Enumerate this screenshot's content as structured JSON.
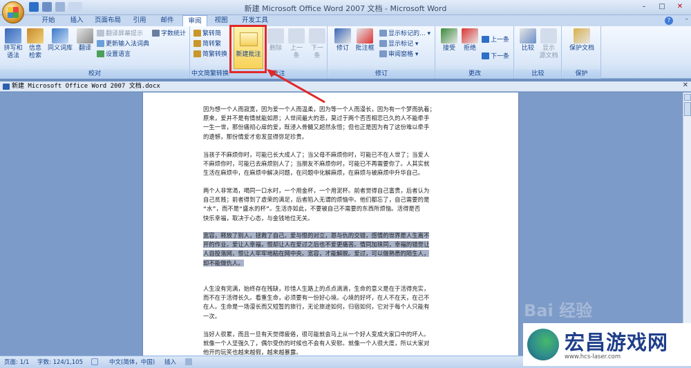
{
  "window": {
    "title": "新建 Microsoft Office Word 2007 文档 - Microsoft Word",
    "minimize": "–",
    "maximize": "□",
    "close": "✕"
  },
  "tabs": [
    "开始",
    "插入",
    "页面布局",
    "引用",
    "邮件",
    "审阅",
    "视图",
    "开发工具"
  ],
  "active_tab": "审阅",
  "ribbon": {
    "proof": {
      "spell": "拼写和\n语法",
      "research": "信息\n检索",
      "thesaurus": "同义词库",
      "translate": "翻译",
      "tooltip": "翻译屏幕提示",
      "update_ime": "更新输入法词典",
      "language": "设置语言",
      "wordcount": "字数统计",
      "label": "校对"
    },
    "chinese": {
      "t2s": "繁转简",
      "s2t": "简转繁",
      "convert": "简繁转换",
      "label": "中文简繁转换"
    },
    "comments": {
      "new": "新建批注",
      "delete": "删除",
      "prev": "上一\n条",
      "next": "下一\n条",
      "label": "批注"
    },
    "tracking": {
      "track": "修订",
      "balloons": "批注框",
      "display_mode": "显示标记的...",
      "show_markup": "显示标记",
      "review_pane": "审阅窗格",
      "label": "修订"
    },
    "changes": {
      "accept": "接受",
      "reject": "拒绝",
      "prev": "上一条",
      "next": "下一条",
      "label": "更改"
    },
    "compare": {
      "compare": "比较",
      "show_source": "显示\n源文档",
      "label": "比较"
    },
    "protect": {
      "protect_doc": "保护文档",
      "label": "保护"
    }
  },
  "document": {
    "tab_name": "新建 Microsoft Office Word 2007 文档.docx",
    "paragraphs": [
      [
        "因为想一个人而寂寞，因为爱一个人而温柔，因为等一个人而漫长，因为有一个梦而执着；",
        "原来，爱并不是有情就能如愿；人世间最大的悲，莫过于两个否否相恋已久的人不能牵手",
        "一生一世，那份痛彻心扉的爱，既浸入骨髓又超然永恒；但也正是因为有了这份难以牵手",
        "的遗憾，那份情爱才愈发显得弥足珍贵。"
      ],
      [
        "当孩子不麻烦你时，可能已长大成人了；当父母不麻烦你时，可能已不在人世了；当爱人",
        "不麻烦你时，可能已去麻烦别人了；当朋友不麻烦你时，可能已不再需要你了。人其实就",
        "生活在麻烦中，在麻烦中解决问题，在问题中化解麻烦，在麻烦与被麻烦中升华自己。"
      ],
      [
        "两个人非常渴，喝同一口水时，一个用金杯，一个用泥杯。前者觉得自己富贵，后者认为",
        "自己贫贱；前者得到了虚荣的满足，后者陷入无谓的烦恼中。他们都忘了，自己需要的是",
        "“水”，而不是“盛水的杯”。生活亦如此，不要被自己不需要的东西所烦恼。活得是否",
        "快乐幸福，取决于心态，与金钱地位无关。"
      ],
      [
        "宽容，释放了别人，拯救了自己。爱与恨的对立，恩与仇的交错，感情的世界是人生离不",
        "开的作业。爱让人幸福，恨却让人在爱过之后也不爱更痛苦。情同加珠同，幸福的错觉让",
        "人自投落网，恨让人牢牢地粘在网中央。宽容，才能解脱。爱过，可以做熟悉的陌生人，",
        "却不能做仇人。"
      ],
      [
        "人生没有完满，始终存在残缺，珍惜人生路上的点点滴滴，生命的意义是在于活得充实，",
        "而不在于活得长久。看重生命，必须要有一份好心境。心境的好坏，在人不在天，在己不",
        "在人。生命是一场漫长而又短暂的旅行，无论旅途如何，归宿如何，它对于每个人只能有",
        "一次。"
      ],
      [
        "当好人很累，而且一旦有天觉得疲倦，很可能就会马上从一个好人变成大家口中的坏人。",
        "就像一个人坚强久了，偶尔受伤的时候也不会有人安慰。就像一个人很大度，所以大家对",
        "他开的玩笑也越来越假，越来越暴露。"
      ]
    ]
  },
  "status": {
    "page": "页面: 1/1",
    "words": "字数: 124/1,105",
    "lang": "中文(简体，中国)",
    "insert": "插入"
  },
  "watermark": {
    "brand": "宏昌游戏网",
    "url": "www.hcs-laser.com",
    "baidu": "Bai 经验"
  }
}
